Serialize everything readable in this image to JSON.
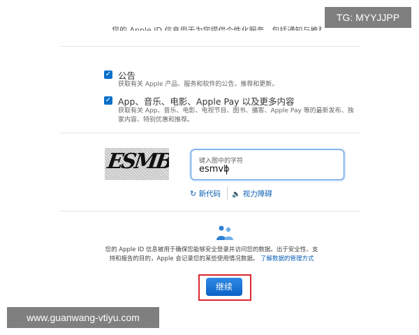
{
  "top_partial_text": "您的 Apple ID 信息用于为您提供个性化服务，包括通知与推荐。",
  "options": [
    {
      "title": "公告",
      "description": "获取有关 Apple 产品、服务和软件的公告，推荐和更新。",
      "checked": true
    },
    {
      "title": "App、音乐、电影、Apple Pay 以及更多内容",
      "description": "获取有关 App、音乐、电影、电视节目、图书、播客、Apple Pay 等的最新发布、独家内容、特别优惠和推荐。",
      "checked": true
    }
  ],
  "captcha": {
    "image_text": "ESMB",
    "input_label": "键入图中的字符",
    "input_value": "esmvb"
  },
  "links": {
    "new_code": "新代码",
    "vision_impaired": "视力障碍"
  },
  "info": {
    "text": "您的 Apple ID 信息被用于确保您能够安全登录并访问您的数据。出于安全性、支持和报告的目的，Apple 会记录您的某些使用情况数据。",
    "link": "了解数据的管理方式"
  },
  "continue_label": "继续",
  "watermarks": {
    "tg": "TG: MYYJJPP",
    "url": "www.guanwang-vtiyu.com"
  },
  "colors": {
    "accent": "#0a70c9",
    "link": "#0a5fb4",
    "highlight": "#d9272e"
  }
}
